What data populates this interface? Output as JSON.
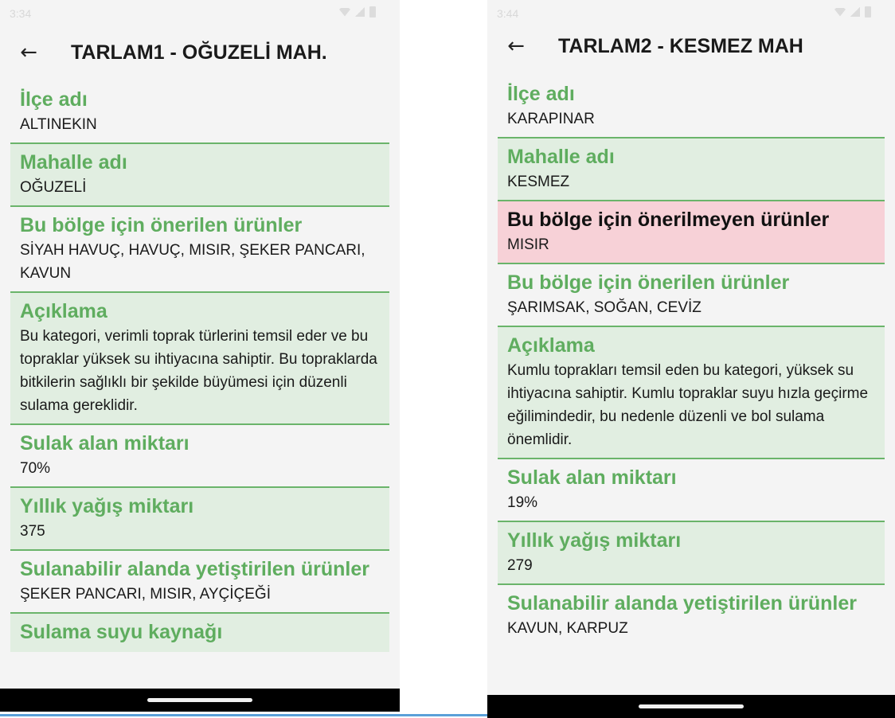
{
  "screens": [
    {
      "status_time": "3:34",
      "title": "TARLAM1 - OĞUZELİ MAH.",
      "sections": [
        {
          "label": "İlçe adı",
          "value": "ALTINEKIN"
        },
        {
          "label": "Mahalle adı",
          "value": "OĞUZELİ"
        },
        {
          "label": "Bu bölge için önerilen ürünler",
          "value": "SİYAH HAVUÇ, HAVUÇ, MISIR, ŞEKER PANCARI, KAVUN"
        },
        {
          "label": "Açıklama",
          "value": "Bu kategori, verimli toprak türlerini temsil eder ve bu topraklar yüksek su ihtiyacına sahiptir. Bu topraklarda bitkilerin sağlıklı bir şekilde büyümesi için düzenli sulama gereklidir."
        },
        {
          "label": "Sulak alan miktarı",
          "value": "70%"
        },
        {
          "label": "Yıllık yağış miktarı",
          "value": "375"
        },
        {
          "label": "Sulanabilir alanda yetiştirilen ürünler",
          "value": "ŞEKER PANCARI, MISIR, AYÇİÇEĞİ"
        },
        {
          "label": "Sulama suyu kaynağı",
          "value": ""
        }
      ]
    },
    {
      "status_time": "3:44",
      "title": "TARLAM2 - KESMEZ MAH",
      "sections": [
        {
          "label": "İlçe adı",
          "value": "KARAPINAR"
        },
        {
          "label": "Mahalle adı",
          "value": "KESMEZ"
        },
        {
          "label": "Bu bölge için önerilmeyen ürünler",
          "value": "MISIR"
        },
        {
          "label": "Bu bölge için önerilen ürünler",
          "value": "ŞARIMSAK, SOĞAN, CEVİZ"
        },
        {
          "label": "Açıklama",
          "value": "Kumlu toprakları temsil eden bu kategori, yüksek su ihtiyacına sahiptir. Kumlu topraklar suyu hızla geçirme eğilimindedir, bu nedenle düzenli ve bol sulama önemlidir."
        },
        {
          "label": "Sulak alan miktarı",
          "value": "19%"
        },
        {
          "label": "Yıllık yağış miktarı",
          "value": "279"
        },
        {
          "label": "Sulanabilir alanda yetiştirilen ürünler",
          "value": "KAVUN, KARPUZ"
        }
      ]
    }
  ],
  "icons": {
    "back": "arrow-back-icon",
    "wifi": "wifi-icon",
    "signal": "signal-icon",
    "battery": "battery-icon"
  },
  "colors": {
    "label_green": "#5fad5f",
    "section_green": "#e1eee1",
    "warning_red": "#f7d1d7",
    "divider": "#6ab46a"
  }
}
